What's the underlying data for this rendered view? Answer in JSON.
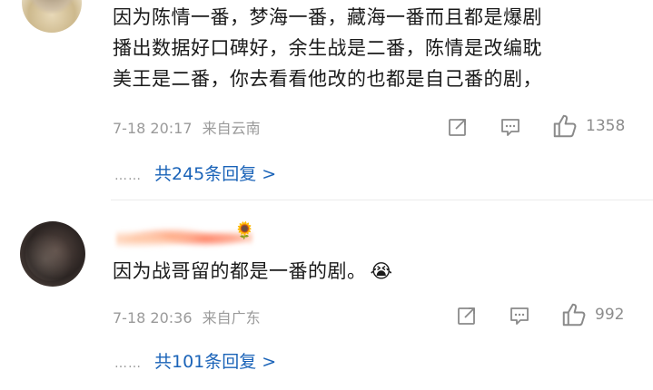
{
  "comment1": {
    "lines": [
      "因为陈情一番，梦海一番，藏海一番而且都是爆剧",
      "播出数据好口碑好，余生战是二番，陈情是改编耽",
      "美王是二番，你去看看他改的也都是自己番的剧，"
    ],
    "time": "7-18 20:17",
    "location": "来自云南",
    "like_count": "1358",
    "replies_dots": "……",
    "replies_text": "共245条回复 >"
  },
  "comment2": {
    "text": "因为战哥留的都是一番的剧。",
    "emoji": "😭",
    "time": "7-18 20:36",
    "location": "来自广东",
    "like_count": "992",
    "replies_dots": "……",
    "replies_text": "共101条回复 >"
  },
  "icons": [
    "share-icon",
    "comment-icon",
    "like-icon"
  ]
}
